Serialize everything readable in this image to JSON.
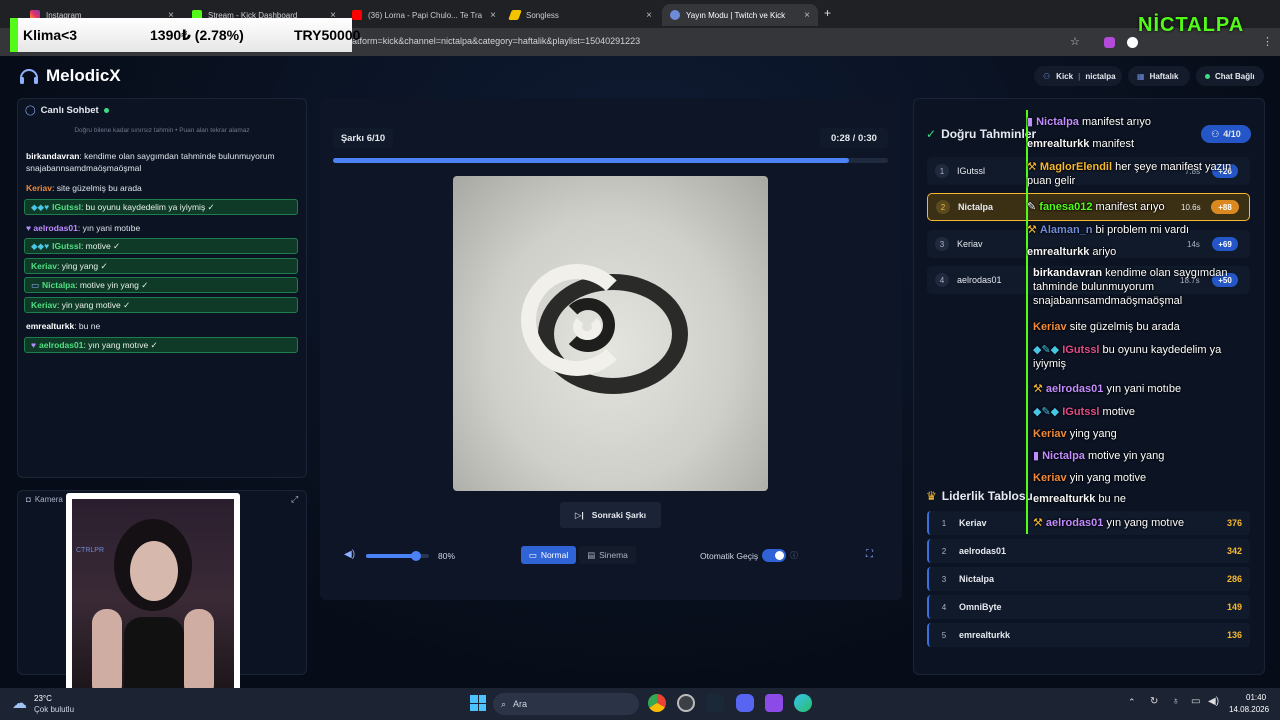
{
  "browser": {
    "tabs": [
      {
        "label": "Instagram",
        "icon": "instagram-icon"
      },
      {
        "label": "Stream - Kick Dashboard",
        "icon": "kick-icon"
      },
      {
        "label": "(36) Lorna - Papi Chulo... Te Tra",
        "icon": "youtube-icon"
      },
      {
        "label": "Songless",
        "icon": "songless-icon"
      },
      {
        "label": "Yayın Modu | Twitch ve Kick",
        "icon": "globe-icon"
      }
    ],
    "url": "atform=kick&channel=nictalpa&category=haftalik&playlist=15040291223"
  },
  "ticker": {
    "left": "Klima<3",
    "price": "1390₺ (2.78%)",
    "right": "TRY50000"
  },
  "brand_overlay": "NİCTALPA",
  "app": {
    "name": "MelodicX",
    "header": {
      "platform": "Kick",
      "channel": "nictalpa",
      "category": "Haftalık",
      "status": "Chat Bağlı"
    }
  },
  "chat": {
    "title": "Canlı Sohbet",
    "subtitle": "Doğru bilene kadar sınırsız tahmin • Puan alan tekrar alamaz",
    "msg1_user": "birkandavran",
    "msg1_text": ": kendime olan saygımdan tahminde bulunmuyorum snajabannsamdmaöşmaöşmal",
    "msg2_user": "Keriav",
    "msg2_text": ": site güzelmiş bu arada",
    "msg3_user": "IGutssl",
    "msg3_text": ": bu oyunu kaydedelim ya iyiymiş ✓",
    "msg4_user": "aelrodas01",
    "msg4_text": ": yın yani motıbe",
    "msg5_user": "IGutssl",
    "msg5_text": ": motive ✓",
    "msg6_user": "Keriav",
    "msg6_text": ": ying yang ✓",
    "msg7_user": "Nictalpa",
    "msg7_text": ": motive yin yang ✓",
    "msg8_user": "Keriav",
    "msg8_text": ": yin yang motive ✓",
    "msg9_user": "emrealturkk",
    "msg9_text": ": bu ne",
    "msg10_user": "aelrodas01",
    "msg10_text": ": yın yang motıve ✓"
  },
  "camera": {
    "title": "Kamera",
    "tag": "CTRLPR"
  },
  "player": {
    "track": "Şarkı 6/10",
    "time": "0:28 / 0:30",
    "progress": 0.93,
    "next_label": "Sonraki Şarkı",
    "volume": "80%",
    "volume_level": 0.8,
    "mode_normal": "Normal",
    "mode_cinema": "Sinema",
    "auto_label": "Otomatik Geçiş",
    "auto_on": true
  },
  "guesses": {
    "title": "Doğru Tahminler",
    "count": "4/10",
    "rows": [
      {
        "rank": "1",
        "name": "IGutssl",
        "time": "7.8s",
        "points": "+26"
      },
      {
        "rank": "2",
        "name": "Nictalpa",
        "time": "10.6s",
        "points": "+88"
      },
      {
        "rank": "3",
        "name": "Keriav",
        "time": "14s",
        "points": "+69"
      },
      {
        "rank": "4",
        "name": "aelrodas01",
        "time": "18.7s",
        "points": "+50"
      }
    ]
  },
  "leaderboard": {
    "title": "Liderlik Tablosu",
    "rows": [
      {
        "rank": "1",
        "name": "Keriav",
        "score": "376"
      },
      {
        "rank": "2",
        "name": "aelrodas01",
        "score": "342"
      },
      {
        "rank": "3",
        "name": "Nictalpa",
        "score": "286"
      },
      {
        "rank": "4",
        "name": "OmniByte",
        "score": "149"
      },
      {
        "rank": "5",
        "name": "emrealturkk",
        "score": "136"
      }
    ]
  },
  "overlay_chat": {
    "l1_user": "Nictalpa",
    "l1_text": " manifest arıyo",
    "l2_user": "emrealturkk",
    "l2_text": " manifest",
    "l3_user": "MaglorElendil",
    "l3_text": " her şeye manifest yazın puan gelir",
    "l4_user": "fanesa012",
    "l4_text": " manifest arıyo",
    "l5_user": "Alaman_n",
    "l5_text": " bi problem mi vardı",
    "l6_user": "emrealturkk",
    "l6_text": " ariyo",
    "l7_user": "birkandavran",
    "l7_text": " kendime olan saygımdan tahminde bulunmuyorum snajabannsamdmaöşmaöşmal",
    "l8_user": "Keriav",
    "l8_text": " site güzelmiş bu arada",
    "l9_user": "IGutssl",
    "l9_text": " bu oyunu kaydedelim ya iyiymiş",
    "l10_user": "aelrodas01",
    "l10_text": " yın yani motıbe",
    "l11_user": "IGutssl",
    "l11_text": " motive",
    "l12_user": "Keriav",
    "l12_text": " ying yang",
    "l13_user": "Nictalpa",
    "l13_text": " motive yin yang",
    "l14_user": "Keriav",
    "l14_text": " yin yang motive",
    "l15_user": "emrealturkk",
    "l15_text": " bu ne",
    "l16_user": "aelrodas01",
    "l16_text": " yın yang motıve"
  },
  "taskbar": {
    "weather_temp": "23°C",
    "weather_desc": "Çok bulutlu",
    "search": "Ara",
    "time": "01:40",
    "date": "14.08.2026"
  },
  "colors": {
    "accent": "#4b82f5",
    "kick_green": "#53fc18",
    "gold": "#f5b82e"
  }
}
